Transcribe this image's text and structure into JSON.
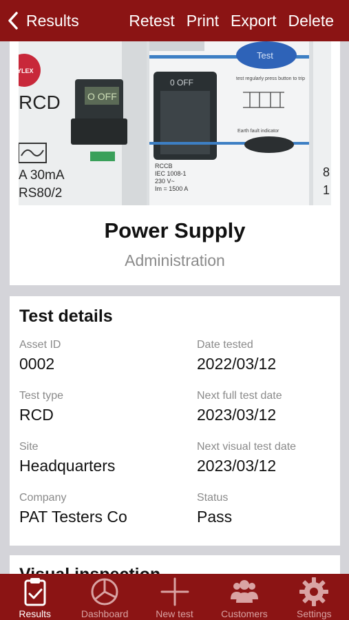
{
  "nav": {
    "back_label": "Results",
    "actions": [
      "Retest",
      "Print",
      "Export",
      "Delete"
    ]
  },
  "asset": {
    "name": "Power Supply",
    "site": "Administration",
    "photo": {
      "left_device": {
        "brand": "YLEX",
        "type": "RCD",
        "switch": "O OFF",
        "rating": "A 30mA",
        "model": "RS80/2"
      },
      "center_device": {
        "switch": "0 OFF",
        "label": "RCCB",
        "standard": "IEC 1008-1",
        "voltage": "230 V~",
        "im": "Im = 1500 A",
        "test_button": "Test",
        "note": "test regularly press button to trip",
        "indicator": "Earth fault indicator"
      },
      "right_device": {
        "label": "8",
        "label2": "1"
      }
    }
  },
  "details": {
    "title": "Test details",
    "fields": [
      {
        "label": "Asset ID",
        "value": "0002"
      },
      {
        "label": "Date tested",
        "value": "2022/03/12"
      },
      {
        "label": "Test type",
        "value": "RCD"
      },
      {
        "label": "Next full test date",
        "value": "2023/03/12"
      },
      {
        "label": "Site",
        "value": "Headquarters"
      },
      {
        "label": "Next visual test date",
        "value": "2023/03/12"
      },
      {
        "label": "Company",
        "value": "PAT Testers Co"
      },
      {
        "label": "Status",
        "value": "Pass"
      }
    ]
  },
  "visual": {
    "title": "Visual inspection"
  },
  "tabs": [
    {
      "label": "Results",
      "icon": "clipboard-check-icon",
      "active": true
    },
    {
      "label": "Dashboard",
      "icon": "pie-chart-icon",
      "active": false
    },
    {
      "label": "New test",
      "icon": "plus-icon",
      "active": false
    },
    {
      "label": "Customers",
      "icon": "users-icon",
      "active": false
    },
    {
      "label": "Settings",
      "icon": "gear-icon",
      "active": false
    }
  ],
  "colors": {
    "brand": "#8b1414",
    "background": "#d4d4d9",
    "muted_text": "#8a8a8a"
  }
}
